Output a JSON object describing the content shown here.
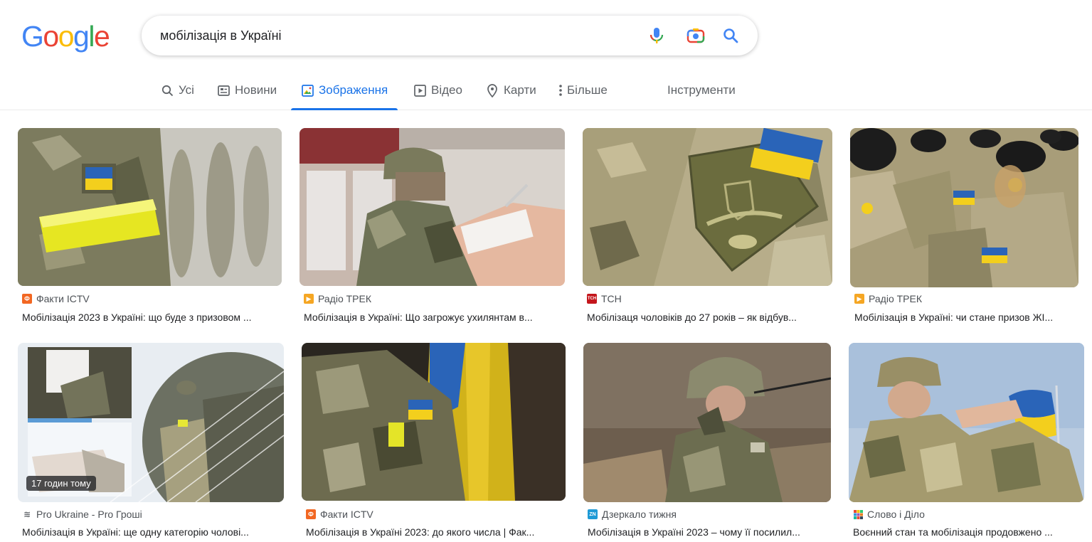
{
  "logo": {
    "text": [
      "G",
      "o",
      "o",
      "g",
      "l",
      "e"
    ],
    "colors": [
      "#4285F4",
      "#EA4335",
      "#FBBC05",
      "#4285F4",
      "#34A853",
      "#EA4335"
    ]
  },
  "search": {
    "query": "мобілізація в Україні"
  },
  "tabs": [
    {
      "label": "Усі",
      "icon": "search-icon"
    },
    {
      "label": "Новини",
      "icon": "news-icon"
    },
    {
      "label": "Зображення",
      "icon": "image-icon",
      "active": true
    },
    {
      "label": "Відео",
      "icon": "play-icon"
    },
    {
      "label": "Карти",
      "icon": "map-pin-icon"
    },
    {
      "label": "Більше",
      "icon": "more-vert-icon"
    }
  ],
  "tools_label": "Інструменти",
  "results": [
    {
      "source": "Факти ICTV",
      "favicon": "ictv-favicon",
      "title": "Мобілізація 2023 в Україні: що буде з призовом ..."
    },
    {
      "source": "Радіо ТРЕК",
      "favicon": "radiotrek-favicon",
      "title": "Мобілізація в Україні: Що загрожує ухилянтам в..."
    },
    {
      "source": "ТСН",
      "favicon": "tsn-favicon",
      "title": "Мобілізаця чоловіків до 27 років – як відбув..."
    },
    {
      "source": "Радіо ТРЕК",
      "favicon": "radiotrek-favicon",
      "title": "Мобілізація в Україні: чи стане призов ЖІ..."
    },
    {
      "source": "Pro Ukraine - Pro Гроші",
      "favicon": "proukraine-favicon",
      "title": "Мобілізація в Україні: ще одну категорію чолові...",
      "badge": "17 годин тому"
    },
    {
      "source": "Факти ICTV",
      "favicon": "ictv-favicon",
      "title": "Мобілізація в Україні 2023: до якого числа | Фак..."
    },
    {
      "source": "Дзеркало тижня",
      "favicon": "zn-favicon",
      "title": "Мобілізація в Україні 2023 – чому її посилил..."
    },
    {
      "source": "Слово і Діло",
      "favicon": "slovoidilo-favicon",
      "title": "Воєнний стан та мобілізація продовжено ..."
    }
  ],
  "colors": {
    "accent": "#1a73e8",
    "flag_blue": "#2a64b8",
    "flag_yellow": "#f3cf1d"
  }
}
